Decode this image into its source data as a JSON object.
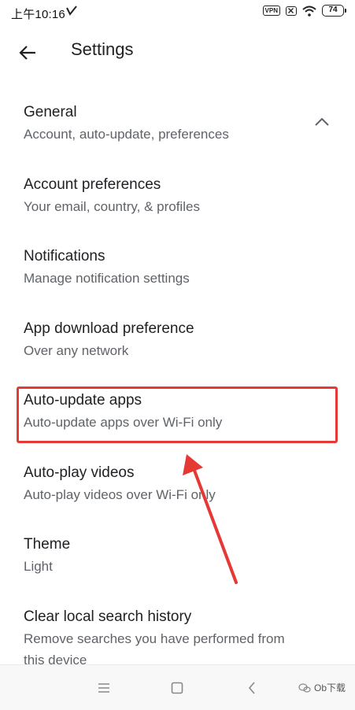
{
  "status_bar": {
    "time": "上午10:16",
    "vpn_label": "VPN",
    "battery_level": "74"
  },
  "app_bar": {
    "title": "Settings"
  },
  "settings": {
    "items": [
      {
        "title": "General",
        "subtitle": "Account, auto-update, preferences"
      },
      {
        "title": "Account preferences",
        "subtitle": "Your email, country, & profiles"
      },
      {
        "title": "Notifications",
        "subtitle": "Manage notification settings"
      },
      {
        "title": "App download preference",
        "subtitle": "Over any network"
      },
      {
        "title": "Auto-update apps",
        "subtitle": "Auto-update apps over Wi-Fi only"
      },
      {
        "title": "Auto-play videos",
        "subtitle": "Auto-play videos over Wi-Fi only"
      },
      {
        "title": "Theme",
        "subtitle": "Light"
      },
      {
        "title": "Clear local search history",
        "subtitle": "Remove searches you have performed from",
        "subtitle_line2": "this device"
      }
    ]
  },
  "watermark": {
    "text": "Ob下载"
  },
  "colors": {
    "highlight": "#e53935",
    "title_text": "#202124",
    "subtitle_text": "#5f6368"
  }
}
